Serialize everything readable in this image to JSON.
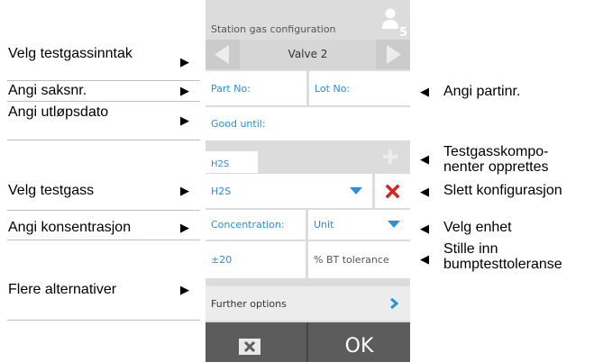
{
  "annotations_left": {
    "select_inlet": "Velg testgassinntak",
    "enter_part_no": "Angi saksnr.",
    "enter_expiry": "Angi utløpsdato",
    "select_gas": "Velg testgass",
    "enter_concentration": "Angi konsentrasjon",
    "more_options": "Flere alternativer"
  },
  "annotations_right": {
    "enter_lot_no": "Angi partinr.",
    "components_line1": "Testgasskompo-",
    "components_line2": "nenter opprettes",
    "delete_config": "Slett konfigurasjon",
    "select_unit": "Velg enhet",
    "tolerance_line1": "Stille inn",
    "tolerance_line2": "bumptesttoleranse"
  },
  "device": {
    "title": "Station gas configuration",
    "user_badge": "5",
    "valve_label": "Valve 2",
    "part_no_label": "Part No:",
    "lot_no_label": "Lot No:",
    "good_until_label": "Good until:",
    "component_tab": "H2S",
    "gas_select_value": "H2S",
    "concentration_label": "Concentration:",
    "unit_select_value": "Unit",
    "tolerance_value": "±20",
    "tolerance_label": "% BT tolerance",
    "further_options": "Further options",
    "ok_label": "OK"
  },
  "colors": {
    "accent_blue": "#2a8fd6",
    "delete_red": "#e0201f",
    "footer": "#5a5a5a"
  },
  "icons": [
    "user-icon",
    "arrow-left-icon",
    "arrow-right-icon",
    "plus-icon",
    "dropdown-arrow-icon",
    "delete-x-icon",
    "chevron-right-icon",
    "cancel-x-icon",
    "pointer-arrow-icon"
  ]
}
